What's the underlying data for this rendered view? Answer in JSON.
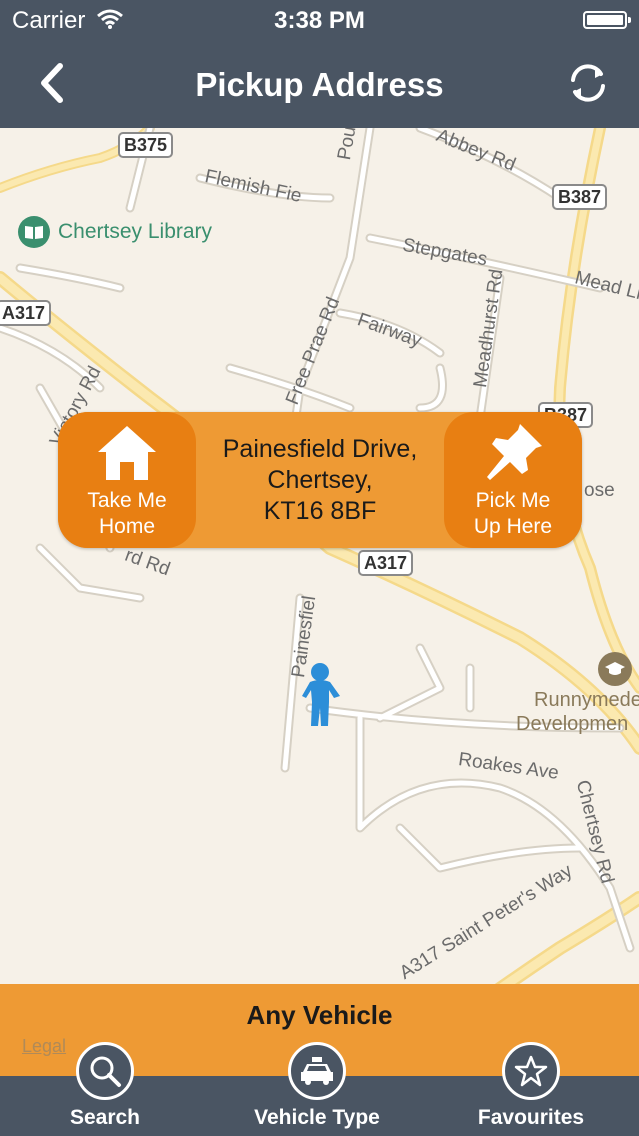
{
  "status_bar": {
    "carrier": "Carrier",
    "time": "3:38 PM",
    "battery_level": 1.0
  },
  "nav": {
    "title": "Pickup Address",
    "back_icon": "chevron-left-icon",
    "refresh_icon": "refresh-icon"
  },
  "map": {
    "roads": {
      "b375": "B375",
      "b387_top": "B387",
      "b387_mid": "B387",
      "a317_left": "A317",
      "a317_right": "A317",
      "abbey_rd": "Abbey Rd",
      "pound_rd": "Pound Rd",
      "flemish_fields": "Flemish Fie",
      "stepgates": "Stepgates",
      "mead_ln": "Mead Ln",
      "fairway": "Fairway",
      "meadhurst_rd": "Meadhurst Rd",
      "free_prae_rd": "Free Prae Rd",
      "victory_rd": "Victory Rd",
      "ose": "ose",
      "painesfield": "Painesfiel",
      "rd_left": "rd Rd",
      "roakes_ave": "Roakes Ave",
      "chertsey_rd": "Chertsey Rd",
      "saint_peters_way": "A317  Saint Peter's Way"
    },
    "pois": {
      "library": "Chertsey Library",
      "runnymede_line1": "Runnymede",
      "runnymede_line2": "Developmen"
    },
    "legal": "Legal"
  },
  "address_panel": {
    "home_label_line1": "Take Me",
    "home_label_line2": "Home",
    "address_line1": "Painesfield Drive,",
    "address_line2": "Chertsey,",
    "address_line3": "KT16 8BF",
    "pick_label_line1": "Pick Me",
    "pick_label_line2": "Up Here"
  },
  "vehicle_bar": {
    "label": "Any Vehicle"
  },
  "tabs": [
    {
      "label": "Search",
      "icon": "search-icon"
    },
    {
      "label": "Vehicle Type",
      "icon": "taxi-icon"
    },
    {
      "label": "Favourites",
      "icon": "star-icon"
    }
  ],
  "colors": {
    "nav": "#4a5563",
    "accent": "#ee9a34",
    "accent_dark": "#e87f12",
    "map_bg": "#f6f1e8"
  }
}
